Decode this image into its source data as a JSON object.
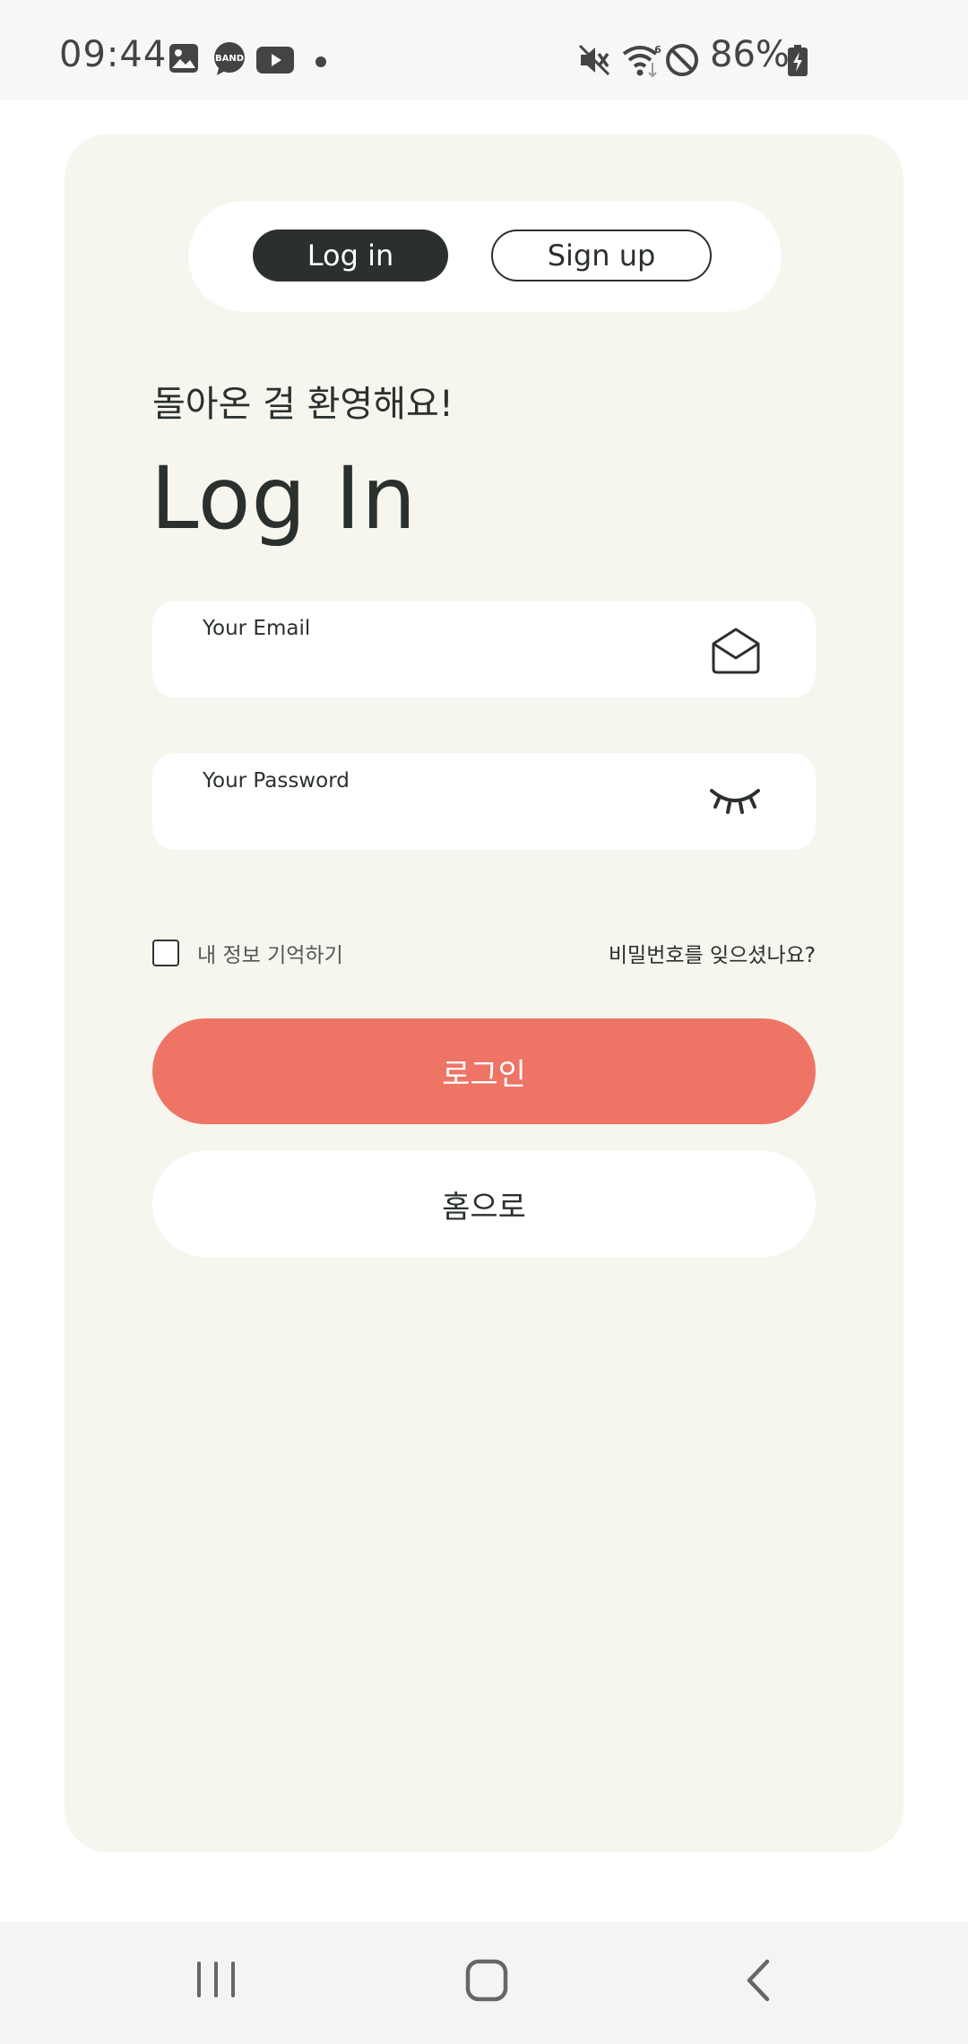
{
  "status_bar": {
    "time": "09:44",
    "notification_icons": [
      "gallery-icon",
      "band-icon",
      "youtube-icon",
      "dot-icon"
    ],
    "system_icons": [
      "mute-icon",
      "wifi-icon",
      "do-not-disturb-icon",
      "battery-charging-icon"
    ],
    "battery": "86%"
  },
  "tabs": {
    "login_label": "Log in",
    "signup_label": "Sign up",
    "active": "login"
  },
  "form": {
    "welcome": "돌아온 걸 환영해요!",
    "title": "Log In",
    "email_label": "Your Email",
    "email_icon": "envelope-icon",
    "password_label": "Your Password",
    "password_icon": "eye-closed-icon",
    "remember_label": "내 정보 기억하기",
    "remember_checked": false,
    "forgot_label": "비밀번호를 잊으셨나요?",
    "login_button": "로그인",
    "home_button": "홈으로"
  },
  "colors": {
    "card_bg": "#f6f5ee",
    "dark": "#2a302d",
    "accent": "#ee7466"
  },
  "nav_bar": {
    "items": [
      "recent-apps-icon",
      "home-icon",
      "back-icon"
    ]
  }
}
